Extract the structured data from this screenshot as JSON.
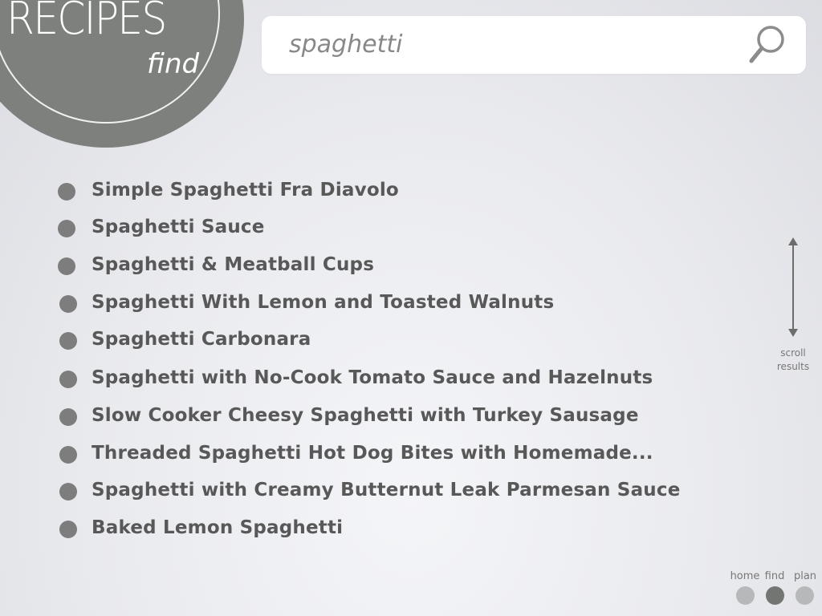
{
  "logo": {
    "title": "RECIPES",
    "subtitle": "find"
  },
  "search": {
    "value": "spaghetti",
    "icon": "search-icon"
  },
  "results": [
    "Simple Spaghetti Fra Diavolo",
    "Spaghetti Sauce",
    "Spaghetti & Meatball Cups",
    "Spaghetti With Lemon and Toasted Walnuts",
    "Spaghetti Carbonara",
    "Spaghetti with No-Cook Tomato Sauce and Hazelnuts",
    "Slow Cooker Cheesy Spaghetti with Turkey Sausage",
    "Threaded Spaghetti Hot Dog Bites with Homemade...",
    "Spaghetti with Creamy Butternut Leak Parmesan Sauce",
    "Baked Lemon Spaghetti"
  ],
  "scroll": {
    "line1": "scroll",
    "line2": "results",
    "icon": "double-arrow-icon"
  },
  "nav": {
    "items": [
      {
        "label": "home",
        "active": false
      },
      {
        "label": "find",
        "active": true
      },
      {
        "label": "plan",
        "active": false
      }
    ]
  },
  "colors": {
    "logo_bg": "#7e807d",
    "text": "#585858",
    "bullet": "#7d7d7d",
    "nav_inactive": "#b7b8ba",
    "nav_active": "#737573"
  }
}
